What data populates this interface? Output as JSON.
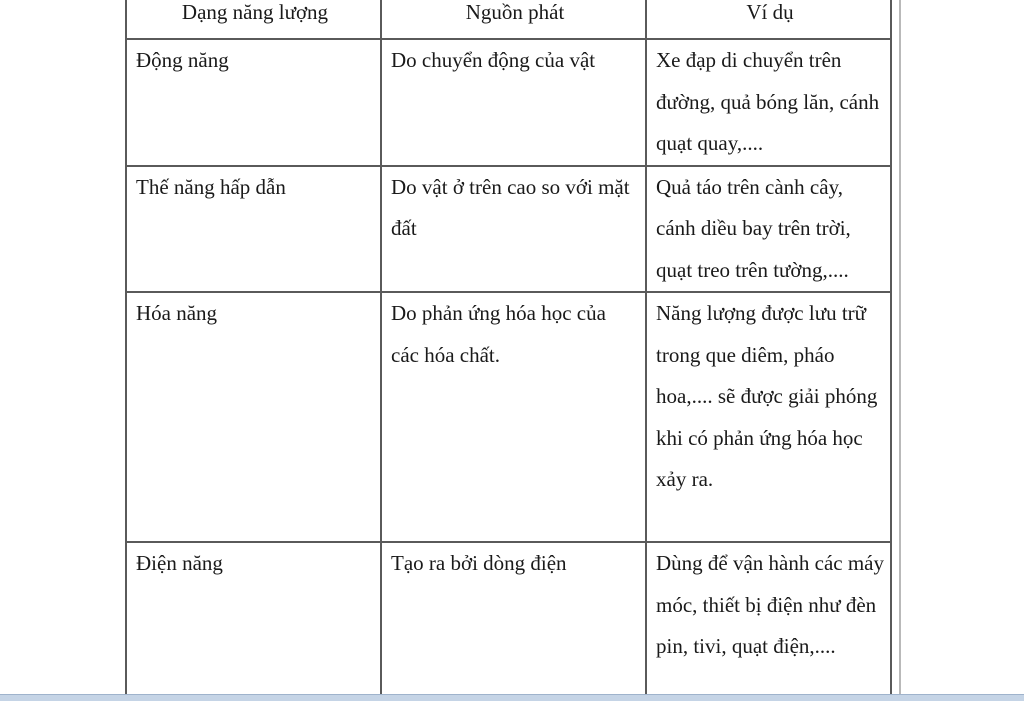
{
  "table": {
    "headers": [
      "Dạng năng lượng",
      "Nguồn phát",
      "Ví dụ"
    ],
    "rows": [
      {
        "form": "Động năng",
        "source": "Do chuyển động của vật",
        "example": "Xe đạp di chuyển trên đường, quả bóng lăn, cánh quạt quay,...."
      },
      {
        "form": "Thế năng hấp dẫn",
        "source": "Do vật ở trên cao so với mặt đất",
        "example": "Quả táo trên cành cây, cánh diều bay trên trời, quạt treo trên tường,...."
      },
      {
        "form": "Hóa năng",
        "source": "Do phản ứng hóa học của các hóa chất.",
        "example": "Năng lượng được lưu trữ trong que diêm, pháo hoa,.... sẽ được giải phóng khi có phản ứng hóa học xảy ra."
      },
      {
        "form": "Điện năng",
        "source": "Tạo ra bởi dòng điện",
        "example": "Dùng để vận hành các máy móc, thiết bị điện như đèn pin, tivi, quạt điện,...."
      }
    ]
  }
}
